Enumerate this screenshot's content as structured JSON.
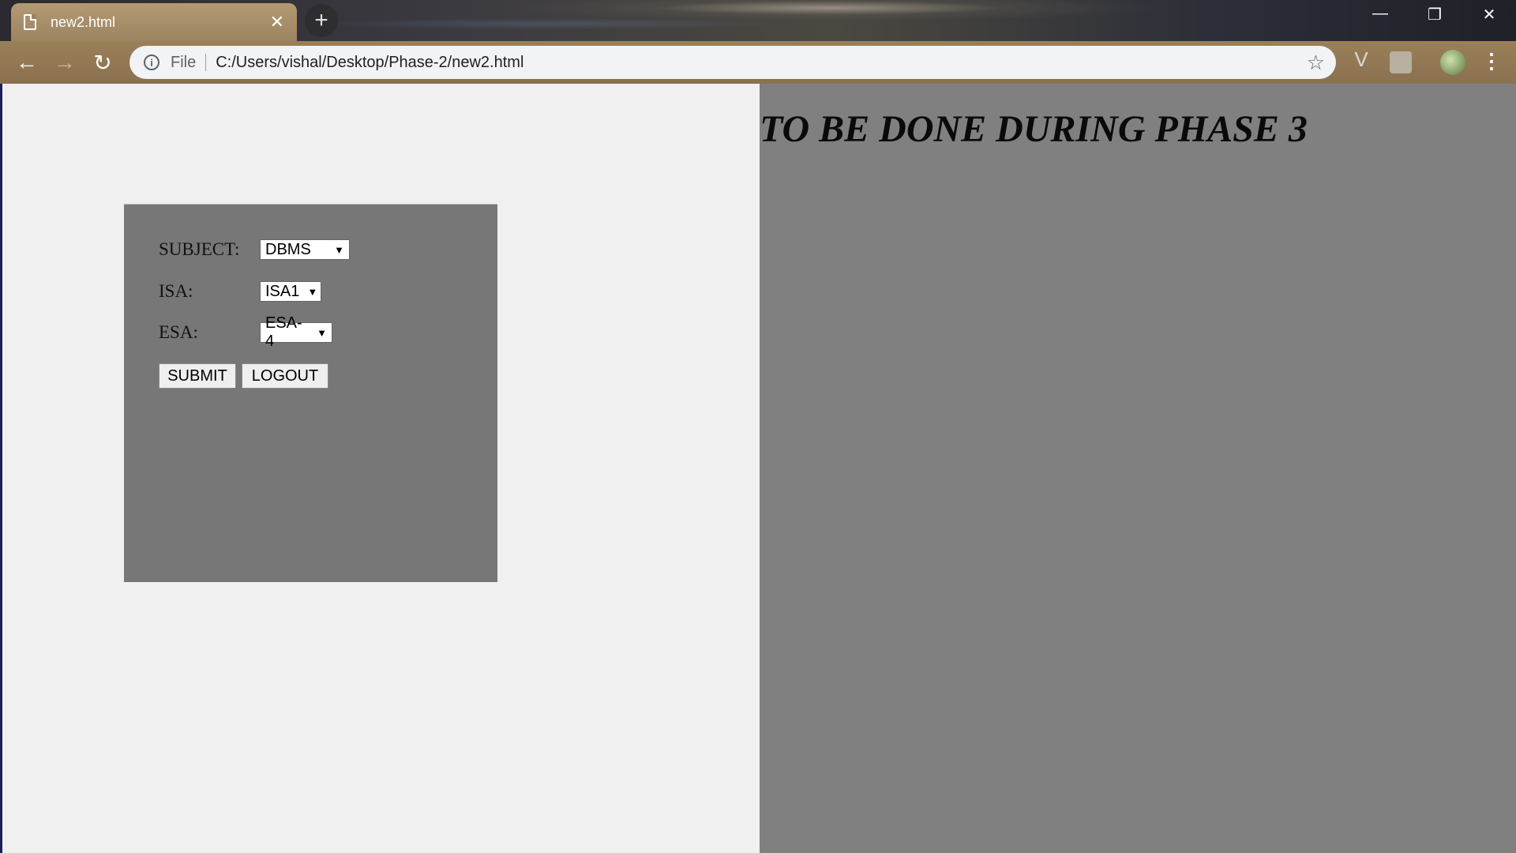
{
  "browser": {
    "tab_title": "new2.html",
    "tab_close": "✕",
    "new_tab": "+",
    "file_label": "File",
    "url": "C:/Users/vishal/Desktop/Phase-2/new2.html",
    "back": "←",
    "forward": "→",
    "reload": "↻",
    "info": "i",
    "star": "☆",
    "minimize": "—",
    "maximize": "❐",
    "close": "✕",
    "menu": "⋮",
    "ext_v": "V"
  },
  "form": {
    "subject_label": "SUBJECT:",
    "subject_value": "DBMS",
    "isa_label": "ISA:",
    "isa_value": "ISA1",
    "esa_label": "ESA:",
    "esa_value": "ESA-4",
    "dropdown_arrow": "▼",
    "submit_label": "SUBMIT",
    "logout_label": "LOGOUT"
  },
  "right_panel": {
    "heading": "TO BE DONE DURING PHASE 3"
  },
  "colors": {
    "form_bg": "#777777",
    "right_bg": "#808080",
    "page_bg": "#f0f0f0"
  }
}
